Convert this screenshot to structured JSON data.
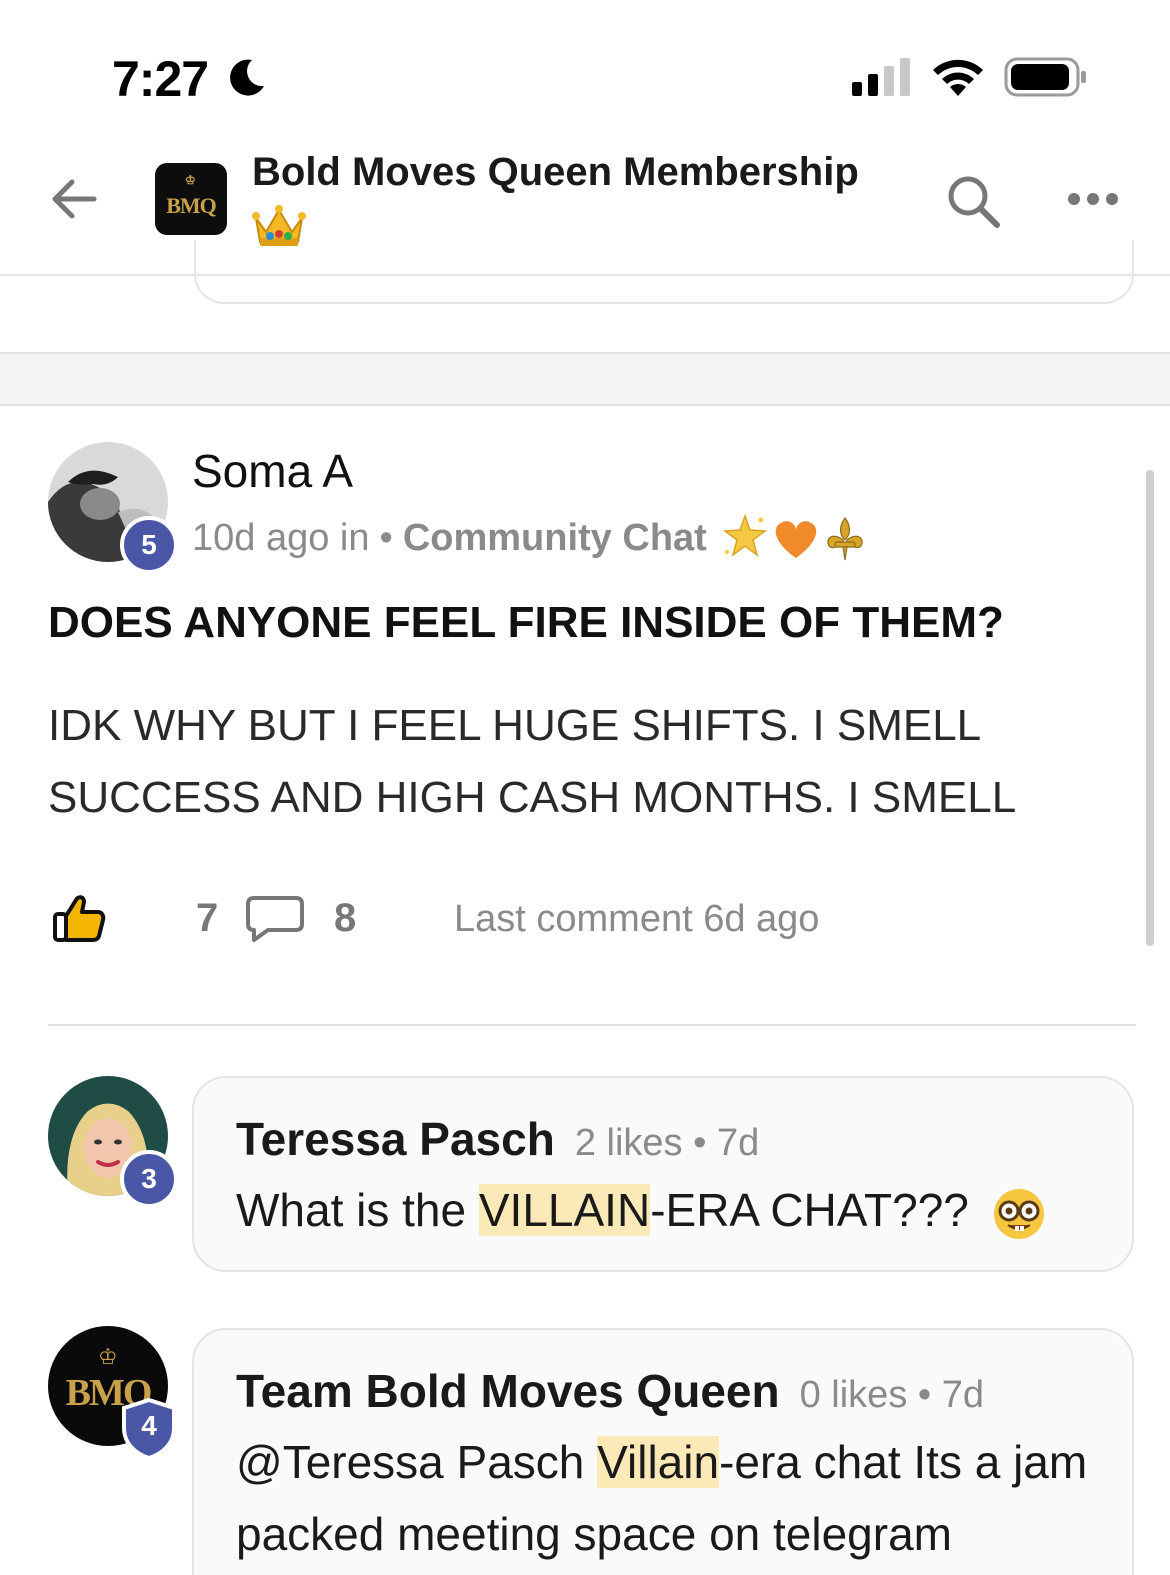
{
  "status_bar": {
    "time": "7:27"
  },
  "header": {
    "title": "Bold Moves Queen Membership",
    "logo_text": "BMQ",
    "title_emoji": "crown-emoji"
  },
  "post": {
    "author": "Soma A",
    "level_badge": "5",
    "time_prefix": "10d ago in",
    "separator": "•",
    "channel": "Community Chat",
    "channel_emojis": [
      "sparkle-star-emoji",
      "orange-heart-emoji",
      "fleur-de-lis-emoji"
    ],
    "title": "DOES ANYONE FEEL FIRE INSIDE OF THEM?",
    "body": "IDK WHY BUT I FEEL HUGE SHIFTS. I SMELL SUCCESS AND HIGH CASH MONTHS. I SMELL",
    "like_count": "7",
    "comment_count": "8",
    "last_comment": "Last comment 6d ago"
  },
  "comments": [
    {
      "author": "Teressa Pasch",
      "level_badge": "3",
      "meta": "2 likes • 7d",
      "text_before": "What is the ",
      "text_highlight": "VILLAIN",
      "text_after": "-ERA CHAT??? ",
      "emoji": "nerd-face-emoji"
    },
    {
      "author": "Team Bold Moves Queen",
      "level_badge": "4",
      "avatar_text": "BMQ",
      "meta": "0 likes • 7d",
      "text_before": "@Teressa Pasch ",
      "text_highlight": "Villain",
      "text_after": "-era chat Its a jam packed meeting space on telegram"
    }
  ],
  "colors": {
    "badge": "#4a56a6",
    "highlight": "#fbe9b8",
    "meta_gray": "#8a8a8a"
  }
}
